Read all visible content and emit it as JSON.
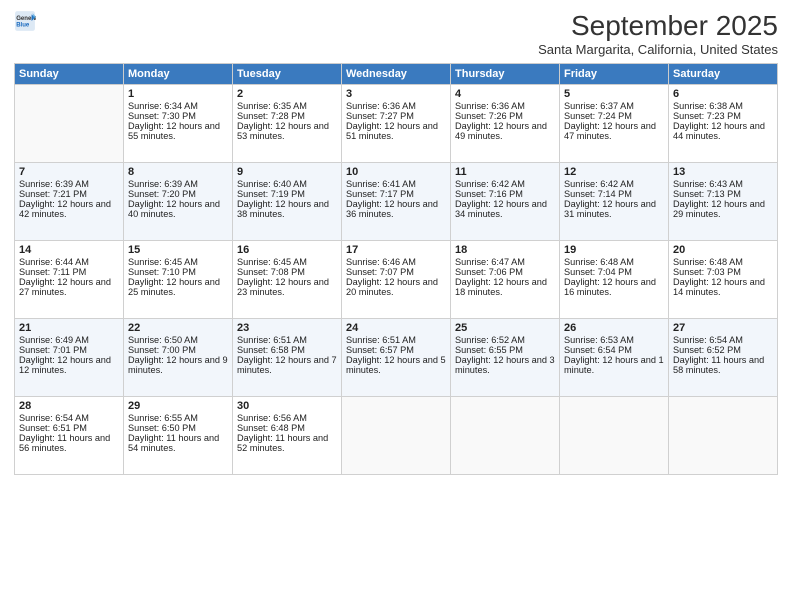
{
  "header": {
    "logo_line1": "General",
    "logo_line2": "Blue",
    "month": "September 2025",
    "location": "Santa Margarita, California, United States"
  },
  "days_of_week": [
    "Sunday",
    "Monday",
    "Tuesday",
    "Wednesday",
    "Thursday",
    "Friday",
    "Saturday"
  ],
  "weeks": [
    [
      {
        "day": "",
        "sunrise": "",
        "sunset": "",
        "daylight": ""
      },
      {
        "day": "1",
        "sunrise": "Sunrise: 6:34 AM",
        "sunset": "Sunset: 7:30 PM",
        "daylight": "Daylight: 12 hours and 55 minutes."
      },
      {
        "day": "2",
        "sunrise": "Sunrise: 6:35 AM",
        "sunset": "Sunset: 7:28 PM",
        "daylight": "Daylight: 12 hours and 53 minutes."
      },
      {
        "day": "3",
        "sunrise": "Sunrise: 6:36 AM",
        "sunset": "Sunset: 7:27 PM",
        "daylight": "Daylight: 12 hours and 51 minutes."
      },
      {
        "day": "4",
        "sunrise": "Sunrise: 6:36 AM",
        "sunset": "Sunset: 7:26 PM",
        "daylight": "Daylight: 12 hours and 49 minutes."
      },
      {
        "day": "5",
        "sunrise": "Sunrise: 6:37 AM",
        "sunset": "Sunset: 7:24 PM",
        "daylight": "Daylight: 12 hours and 47 minutes."
      },
      {
        "day": "6",
        "sunrise": "Sunrise: 6:38 AM",
        "sunset": "Sunset: 7:23 PM",
        "daylight": "Daylight: 12 hours and 44 minutes."
      }
    ],
    [
      {
        "day": "7",
        "sunrise": "Sunrise: 6:39 AM",
        "sunset": "Sunset: 7:21 PM",
        "daylight": "Daylight: 12 hours and 42 minutes."
      },
      {
        "day": "8",
        "sunrise": "Sunrise: 6:39 AM",
        "sunset": "Sunset: 7:20 PM",
        "daylight": "Daylight: 12 hours and 40 minutes."
      },
      {
        "day": "9",
        "sunrise": "Sunrise: 6:40 AM",
        "sunset": "Sunset: 7:19 PM",
        "daylight": "Daylight: 12 hours and 38 minutes."
      },
      {
        "day": "10",
        "sunrise": "Sunrise: 6:41 AM",
        "sunset": "Sunset: 7:17 PM",
        "daylight": "Daylight: 12 hours and 36 minutes."
      },
      {
        "day": "11",
        "sunrise": "Sunrise: 6:42 AM",
        "sunset": "Sunset: 7:16 PM",
        "daylight": "Daylight: 12 hours and 34 minutes."
      },
      {
        "day": "12",
        "sunrise": "Sunrise: 6:42 AM",
        "sunset": "Sunset: 7:14 PM",
        "daylight": "Daylight: 12 hours and 31 minutes."
      },
      {
        "day": "13",
        "sunrise": "Sunrise: 6:43 AM",
        "sunset": "Sunset: 7:13 PM",
        "daylight": "Daylight: 12 hours and 29 minutes."
      }
    ],
    [
      {
        "day": "14",
        "sunrise": "Sunrise: 6:44 AM",
        "sunset": "Sunset: 7:11 PM",
        "daylight": "Daylight: 12 hours and 27 minutes."
      },
      {
        "day": "15",
        "sunrise": "Sunrise: 6:45 AM",
        "sunset": "Sunset: 7:10 PM",
        "daylight": "Daylight: 12 hours and 25 minutes."
      },
      {
        "day": "16",
        "sunrise": "Sunrise: 6:45 AM",
        "sunset": "Sunset: 7:08 PM",
        "daylight": "Daylight: 12 hours and 23 minutes."
      },
      {
        "day": "17",
        "sunrise": "Sunrise: 6:46 AM",
        "sunset": "Sunset: 7:07 PM",
        "daylight": "Daylight: 12 hours and 20 minutes."
      },
      {
        "day": "18",
        "sunrise": "Sunrise: 6:47 AM",
        "sunset": "Sunset: 7:06 PM",
        "daylight": "Daylight: 12 hours and 18 minutes."
      },
      {
        "day": "19",
        "sunrise": "Sunrise: 6:48 AM",
        "sunset": "Sunset: 7:04 PM",
        "daylight": "Daylight: 12 hours and 16 minutes."
      },
      {
        "day": "20",
        "sunrise": "Sunrise: 6:48 AM",
        "sunset": "Sunset: 7:03 PM",
        "daylight": "Daylight: 12 hours and 14 minutes."
      }
    ],
    [
      {
        "day": "21",
        "sunrise": "Sunrise: 6:49 AM",
        "sunset": "Sunset: 7:01 PM",
        "daylight": "Daylight: 12 hours and 12 minutes."
      },
      {
        "day": "22",
        "sunrise": "Sunrise: 6:50 AM",
        "sunset": "Sunset: 7:00 PM",
        "daylight": "Daylight: 12 hours and 9 minutes."
      },
      {
        "day": "23",
        "sunrise": "Sunrise: 6:51 AM",
        "sunset": "Sunset: 6:58 PM",
        "daylight": "Daylight: 12 hours and 7 minutes."
      },
      {
        "day": "24",
        "sunrise": "Sunrise: 6:51 AM",
        "sunset": "Sunset: 6:57 PM",
        "daylight": "Daylight: 12 hours and 5 minutes."
      },
      {
        "day": "25",
        "sunrise": "Sunrise: 6:52 AM",
        "sunset": "Sunset: 6:55 PM",
        "daylight": "Daylight: 12 hours and 3 minutes."
      },
      {
        "day": "26",
        "sunrise": "Sunrise: 6:53 AM",
        "sunset": "Sunset: 6:54 PM",
        "daylight": "Daylight: 12 hours and 1 minute."
      },
      {
        "day": "27",
        "sunrise": "Sunrise: 6:54 AM",
        "sunset": "Sunset: 6:52 PM",
        "daylight": "Daylight: 11 hours and 58 minutes."
      }
    ],
    [
      {
        "day": "28",
        "sunrise": "Sunrise: 6:54 AM",
        "sunset": "Sunset: 6:51 PM",
        "daylight": "Daylight: 11 hours and 56 minutes."
      },
      {
        "day": "29",
        "sunrise": "Sunrise: 6:55 AM",
        "sunset": "Sunset: 6:50 PM",
        "daylight": "Daylight: 11 hours and 54 minutes."
      },
      {
        "day": "30",
        "sunrise": "Sunrise: 6:56 AM",
        "sunset": "Sunset: 6:48 PM",
        "daylight": "Daylight: 11 hours and 52 minutes."
      },
      {
        "day": "",
        "sunrise": "",
        "sunset": "",
        "daylight": ""
      },
      {
        "day": "",
        "sunrise": "",
        "sunset": "",
        "daylight": ""
      },
      {
        "day": "",
        "sunrise": "",
        "sunset": "",
        "daylight": ""
      },
      {
        "day": "",
        "sunrise": "",
        "sunset": "",
        "daylight": ""
      }
    ]
  ]
}
